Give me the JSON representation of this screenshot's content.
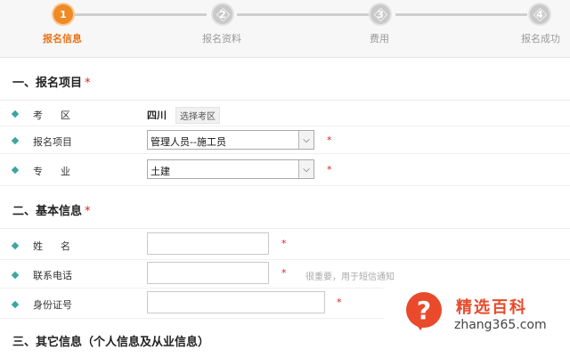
{
  "stepper": {
    "steps": [
      {
        "number": "1",
        "label": "报名信息",
        "state": "active"
      },
      {
        "number": "2",
        "label": "报名资料",
        "state": "pending"
      },
      {
        "number": "3",
        "label": "费用",
        "state": "pending"
      },
      {
        "number": "4",
        "label": "报名成功",
        "state": "pending"
      }
    ],
    "active_color": "#f08a24",
    "inactive_color": "#c9c9c9"
  },
  "section1": {
    "title": "一、报名项目",
    "required_mark": "*",
    "exam_area": {
      "label": "考区",
      "value": "四川",
      "button": "选择考区"
    },
    "project": {
      "label": "报名项目",
      "value": "管理人员--施工员",
      "required_mark": "*"
    },
    "major": {
      "label": "专业",
      "value": "土建",
      "required_mark": "*"
    }
  },
  "section2": {
    "title": "二、基本信息",
    "required_mark": "*",
    "name": {
      "label": "姓名",
      "value": "",
      "required_mark": "*"
    },
    "phone": {
      "label": "联系电话",
      "value": "",
      "required_mark": "*",
      "hint": "很重要，用于短信通知"
    },
    "id_number": {
      "label": "身份证号",
      "value": "",
      "required_mark": "*"
    }
  },
  "section3": {
    "title": "三、其它信息（个人信息及从业信息）"
  },
  "watermark": {
    "icon": "question-mark-icon",
    "brand": "精选百科",
    "domain": "zhang365.com",
    "color": "#e84a2b"
  },
  "colors": {
    "bullet": "#3aa7a0",
    "required": "#e02020"
  }
}
